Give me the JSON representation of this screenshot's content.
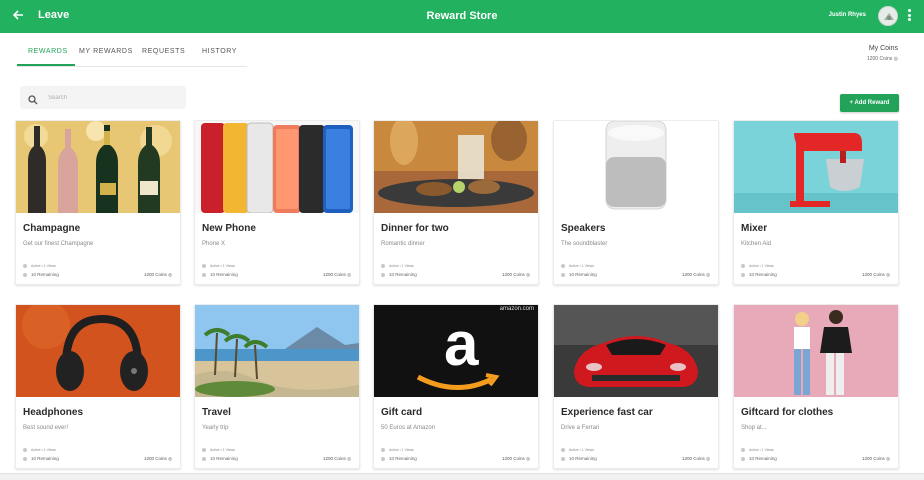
{
  "header": {
    "back_label": "Leave",
    "title": "Reward Store",
    "user_name": "Justin Rhyes",
    "bg_color": "#21b15f",
    "avatar_icon": "logo-icon",
    "menu_icon": "more-vert-icon"
  },
  "tabs": [
    {
      "label": "REWARDS",
      "active": true
    },
    {
      "label": "MY REWARDS",
      "active": false
    },
    {
      "label": "REQUESTS",
      "active": false
    },
    {
      "label": "HISTORY",
      "active": false
    }
  ],
  "coins": {
    "label": "My Coins",
    "value": "1200 Coins"
  },
  "search": {
    "placeholder": "Search"
  },
  "add_button": {
    "label": "+ Add Reward",
    "color": "#21a35a"
  },
  "cards": [
    {
      "name": "Champagne",
      "desc": "Get our finest Champagne",
      "meta1": "Active • 1 Views",
      "remaining": "10 Remaining",
      "coins": "1200 Coins"
    },
    {
      "name": "New Phone",
      "desc": "Phone X",
      "meta1": "Active • 1 Views",
      "remaining": "10 Remaining",
      "coins": "1200 Coins"
    },
    {
      "name": "Dinner for two",
      "desc": "Romantic dinner",
      "meta1": "Active • 1 Views",
      "remaining": "10 Remaining",
      "coins": "1200 Coins"
    },
    {
      "name": "Speakers",
      "desc": "The soundblaster",
      "meta1": "Active • 1 Views",
      "remaining": "10 Remaining",
      "coins": "1200 Coins"
    },
    {
      "name": "Mixer",
      "desc": "Kitchen Aid",
      "meta1": "Active • 1 Views",
      "remaining": "10 Remaining",
      "coins": "1200 Coins"
    },
    {
      "name": "Headphones",
      "desc": "Best sound ever!",
      "meta1": "Active • 1 Views",
      "remaining": "10 Remaining",
      "coins": "1200 Coins"
    },
    {
      "name": "Travel",
      "desc": "Yearly trip",
      "meta1": "Active • 1 Views",
      "remaining": "10 Remaining",
      "coins": "1200 Coins"
    },
    {
      "name": "Gift card",
      "desc": "50 Euros at Amazon",
      "meta1": "Active • 1 Views",
      "remaining": "10 Remaining",
      "coins": "1200 Coins"
    },
    {
      "name": "Experience fast car",
      "desc": "Drive a Ferrari",
      "meta1": "Active • 1 Views",
      "remaining": "10 Remaining",
      "coins": "1200 Coins"
    },
    {
      "name": "Giftcard for clothes",
      "desc": "Shop at...",
      "meta1": "Active • 1 Views",
      "remaining": "10 Remaining",
      "coins": "1200 Coins"
    }
  ],
  "image_text": {
    "amazon_brand": "amazon.com"
  }
}
